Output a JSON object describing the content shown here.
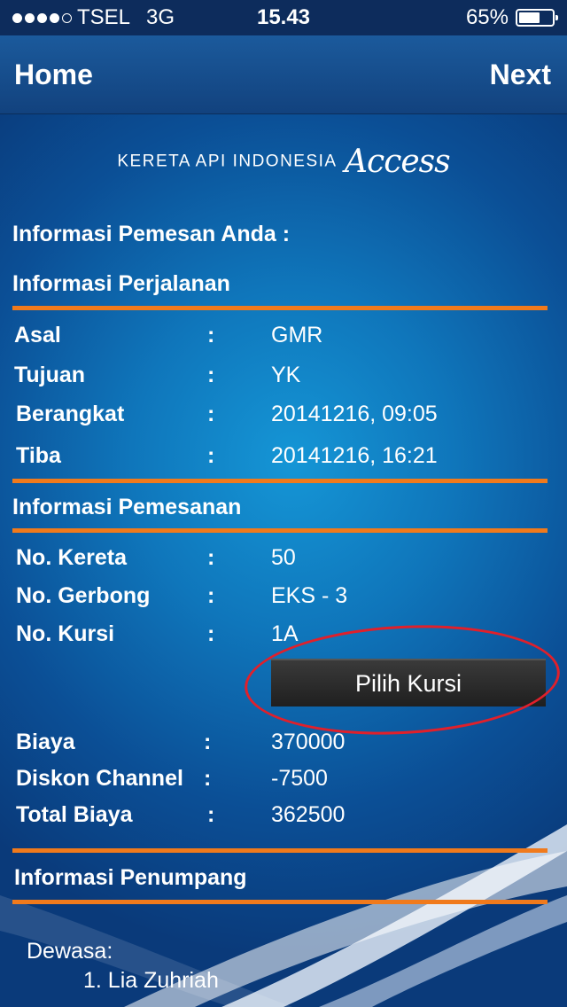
{
  "status_bar": {
    "carrier": "TSEL",
    "network": "3G",
    "time": "15.43",
    "battery": "65%",
    "battery_level": 0.65
  },
  "nav": {
    "left": "Home",
    "right": "Next"
  },
  "brand": {
    "name": "KERETA API INDONESIA",
    "access": "Access"
  },
  "headings": {
    "main": "Informasi Pemesan Anda :",
    "trip": "Informasi Perjalanan",
    "booking": "Informasi Pemesanan",
    "passenger": "Informasi Penumpang"
  },
  "trip": {
    "rows": [
      {
        "label": "Asal",
        "value": "GMR"
      },
      {
        "label": "Tujuan",
        "value": "YK"
      },
      {
        "label": "Berangkat",
        "value": "20141216, 09:05"
      },
      {
        "label": "Tiba",
        "value": "20141216, 16:21"
      }
    ]
  },
  "booking": {
    "rows": [
      {
        "label": "No. Kereta",
        "value": "50"
      },
      {
        "label": "No. Gerbong",
        "value": "EKS - 3"
      },
      {
        "label": "No. Kursi",
        "value": "1A"
      }
    ],
    "pick_seat_label": "Pilih Kursi",
    "cost_rows": [
      {
        "label": "Biaya",
        "value": "370000"
      },
      {
        "label": "Diskon Channel",
        "value": "-7500"
      },
      {
        "label": "Total Biaya",
        "value": "362500"
      }
    ]
  },
  "colon": ":",
  "passenger": {
    "category": "Dewasa:",
    "items": [
      "1. Lia Zuhriah"
    ]
  }
}
